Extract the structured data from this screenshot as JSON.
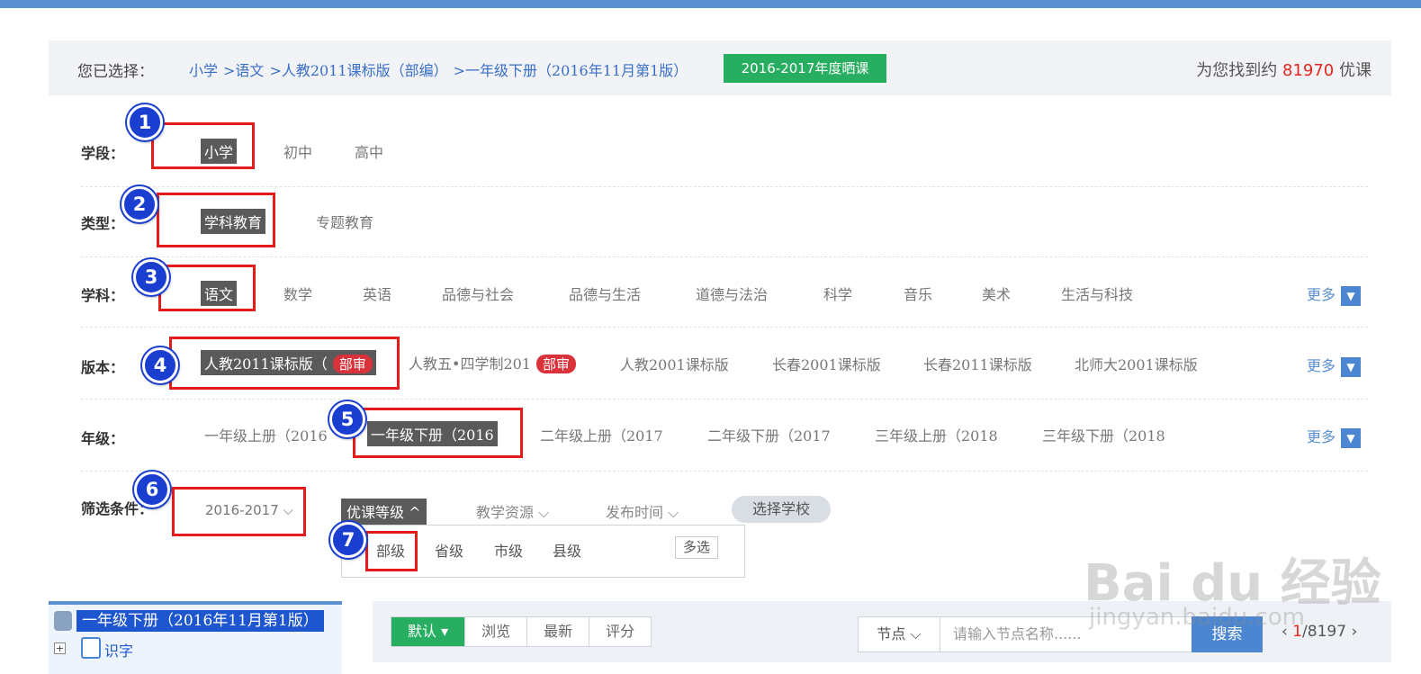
{
  "selected": {
    "label": "您已选择：",
    "crumbs": [
      "小学",
      ">语文",
      ">人教2011课标版（部编）",
      ">一年级下册（2016年11月第1版）"
    ],
    "year_badge": "2016-2017年度晒课",
    "result_prefix": "为您找到约",
    "result_count": "81970",
    "result_suffix": "优课"
  },
  "stage": {
    "label": "学段：",
    "options": [
      "小学",
      "初中",
      "高中"
    ],
    "active": "小学"
  },
  "type": {
    "label": "类型：",
    "options": [
      "学科教育",
      "专题教育"
    ],
    "active": "学科教育"
  },
  "subject": {
    "label": "学科：",
    "options": [
      "语文",
      "数学",
      "英语",
      "品德与社会",
      "品德与生活",
      "道德与法治",
      "科学",
      "音乐",
      "美术",
      "生活与科技"
    ],
    "active": "语文",
    "more": "更多"
  },
  "edition": {
    "label": "版本：",
    "options": [
      "人教2011课标版（",
      "人教五•四学制201",
      "人教2001课标版",
      "长春2001课标版",
      "长春2011课标版",
      "北师大2001课标版"
    ],
    "badge": "部审",
    "more": "更多"
  },
  "grade": {
    "label": "年级：",
    "options": [
      "一年级上册（2016",
      "一年级下册（2016",
      "二年级上册（2017",
      "二年级下册（2017",
      "三年级上册（2018",
      "三年级下册（2018"
    ],
    "more": "更多"
  },
  "filter": {
    "label": "筛选条件：",
    "year": "2016-2017",
    "tabs": [
      "优课等级",
      "教学资源",
      "发布时间"
    ],
    "school_button": "选择学校",
    "levels": [
      "部级",
      "省级",
      "市级",
      "县级"
    ],
    "multi_select": "多选"
  },
  "markers": [
    "1",
    "2",
    "3",
    "4",
    "5",
    "6",
    "7"
  ],
  "tree": {
    "root": "一年级下册（2016年11月第1版）",
    "item": "识字"
  },
  "toolbar": {
    "sort": [
      "默认",
      "浏览",
      "最新",
      "评分"
    ],
    "node_select": "节点",
    "node_placeholder": "请输入节点名称......",
    "search": "搜索",
    "page_current": "1",
    "page_total": "/8197"
  },
  "watermark": {
    "main": "Bai du 经验",
    "sub": "jingyan.baidu.com"
  },
  "icons": {
    "dropdown": "chevron-down-icon",
    "up": "chevron-up-icon",
    "more": "triangle-down-icon"
  },
  "colors": {
    "accent": "#4c86d0",
    "green": "#27ae60",
    "red": "#e2271c",
    "marker": "#1a3fd0"
  }
}
